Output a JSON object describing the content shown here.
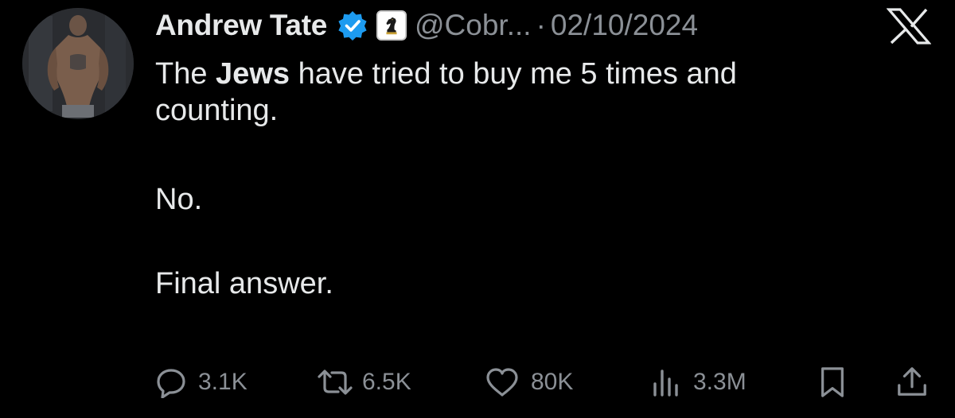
{
  "author": {
    "display_name": "Andrew Tate",
    "handle": "@Cobr...",
    "separator": "·",
    "date": "02/10/2024"
  },
  "tweet": {
    "line1_before": "The ",
    "line1_bold": "Jews",
    "line1_after": " have tried to buy me 5 times and",
    "line2": "counting.",
    "line3": "No.",
    "line4": "Final answer."
  },
  "metrics": {
    "replies": "3.1K",
    "reposts": "6.5K",
    "likes": "80K",
    "views": "3.3M"
  },
  "icons": {
    "verified": "verified-badge-icon",
    "affiliate": "chess-knight-icon",
    "platform": "x-logo-icon",
    "reply": "reply-icon",
    "repost": "repost-icon",
    "like": "heart-icon",
    "views": "views-icon",
    "bookmark": "bookmark-icon",
    "share": "share-icon"
  },
  "colors": {
    "background": "#000000",
    "text": "#e7e9ea",
    "secondary_text": "#8b9096",
    "verified_blue": "#1d9bf0"
  }
}
